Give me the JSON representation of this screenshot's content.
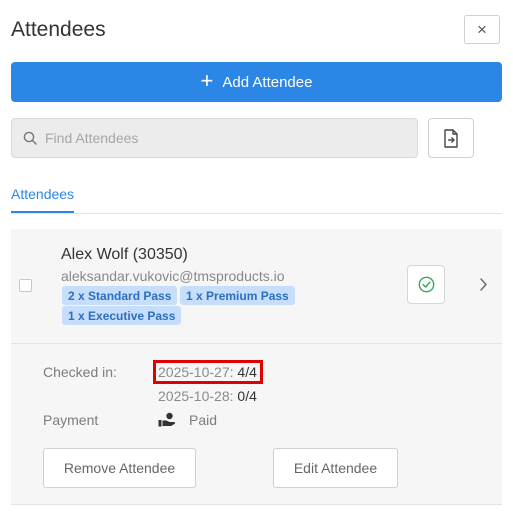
{
  "header": {
    "title": "Attendees",
    "close_label": "×"
  },
  "add_button": {
    "label": "Add Attendee"
  },
  "search": {
    "placeholder": "Find Attendees",
    "value": ""
  },
  "tabs": [
    {
      "label": "Attendees",
      "active": true
    }
  ],
  "attendee": {
    "name": "Alex Wolf (30350)",
    "email": "aleksandar.vukovic@tmsproducts.io",
    "passes": [
      "2 x Standard Pass",
      "1 x Premium Pass",
      "1 x Executive Pass"
    ],
    "checked_in_label": "Checked in:",
    "checkins": [
      {
        "date": "2025-10-27:",
        "count": "4/4"
      },
      {
        "date": "2025-10-28:",
        "count": "0/4"
      }
    ],
    "payment_label": "Payment",
    "payment_status": "Paid",
    "remove_label": "Remove Attendee",
    "edit_label": "Edit Attendee"
  },
  "colors": {
    "accent": "#2b86e5",
    "badge_bg": "#c7defa",
    "badge_text": "#2b6fc0",
    "check_green": "#3aa85a",
    "highlight": "#e00000"
  },
  "icons": {
    "close": "close-icon",
    "add": "plus-icon",
    "search": "search-icon",
    "export": "file-export-icon",
    "check_in": "check-circle-icon",
    "expand": "chevron-right-icon",
    "payment": "hand-money-icon"
  }
}
